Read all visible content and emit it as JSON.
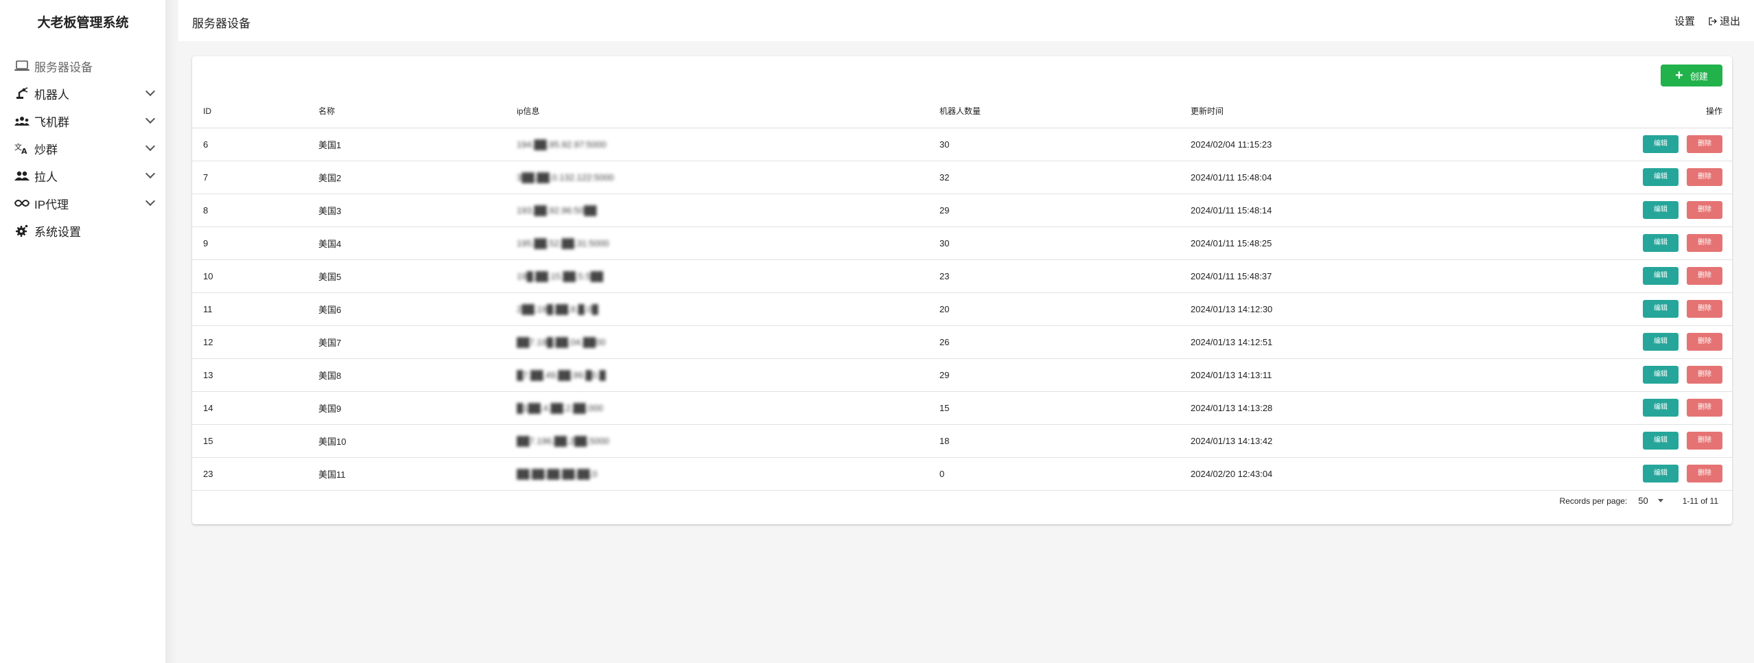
{
  "sidebar": {
    "title": "大老板管理系统",
    "items": [
      {
        "label": "服务器设备",
        "icon": "laptop-icon",
        "expandable": false,
        "active": true
      },
      {
        "label": "机器人",
        "icon": "robot-arm-icon",
        "expandable": true
      },
      {
        "label": "飞机群",
        "icon": "group-icon",
        "expandable": true
      },
      {
        "label": "炒群",
        "icon": "translate-icon",
        "expandable": true
      },
      {
        "label": "拉人",
        "icon": "people-icon",
        "expandable": true
      },
      {
        "label": "IP代理",
        "icon": "infinity-icon",
        "expandable": true
      },
      {
        "label": "系统设置",
        "icon": "gear-icon",
        "expandable": false
      }
    ]
  },
  "header": {
    "title": "服务器设备",
    "settings_label": "设置",
    "logout_label": "退出"
  },
  "toolbar": {
    "create_label": "创建"
  },
  "table": {
    "columns": [
      "ID",
      "名称",
      "ip信息",
      "机器人数量",
      "更新时间",
      "操作"
    ],
    "edit_label": "编辑",
    "delete_label": "删除",
    "rows": [
      {
        "id": "6",
        "name": "美国1",
        "ip": "194.██.95.92.97:5000",
        "count": "30",
        "updated": "2024/02/04 11:15:23"
      },
      {
        "id": "7",
        "name": "美国2",
        "ip": "3██.██.0.132.122:5000",
        "count": "32",
        "updated": "2024/01/11 15:48:04"
      },
      {
        "id": "8",
        "name": "美国3",
        "ip": "193.██.92.96:50██",
        "count": "29",
        "updated": "2024/01/11 15:48:14"
      },
      {
        "id": "9",
        "name": "美国4",
        "ip": "195.██.52.██.31:5000",
        "count": "30",
        "updated": "2024/01/11 15:48:25"
      },
      {
        "id": "10",
        "name": "美国5",
        "ip": "19█.██.15.██.5.5██",
        "count": "23",
        "updated": "2024/01/11 15:48:37"
      },
      {
        "id": "11",
        "name": "美国6",
        "ip": "2██.19█.██.8.█.0█",
        "count": "20",
        "updated": "2024/01/13 14:12:30"
      },
      {
        "id": "12",
        "name": "美国7",
        "ip": "██7.19█.██.04.██00",
        "count": "26",
        "updated": "2024/01/13 14:12:51"
      },
      {
        "id": "13",
        "name": "美国8",
        "ip": "█7.██.49.██.99.█0.█",
        "count": "29",
        "updated": "2024/01/13 14:13:11"
      },
      {
        "id": "14",
        "name": "美国9",
        "ip": "█1██.4.██.2.██.000",
        "count": "15",
        "updated": "2024/01/13 14:13:28"
      },
      {
        "id": "15",
        "name": "美国10",
        "ip": "██7.196.██.2██.5000",
        "count": "18",
        "updated": "2024/01/13 14:13:42"
      },
      {
        "id": "23",
        "name": "美国11",
        "ip": "██.██.██.██.██.0",
        "count": "0",
        "updated": "2024/02/20 12:43:04"
      }
    ]
  },
  "pagination": {
    "records_label": "Records per page:",
    "per_page": "50",
    "range": "1-11 of 11"
  },
  "colors": {
    "create": "#21b24b",
    "edit": "#26a69a",
    "delete": "#e57373"
  }
}
